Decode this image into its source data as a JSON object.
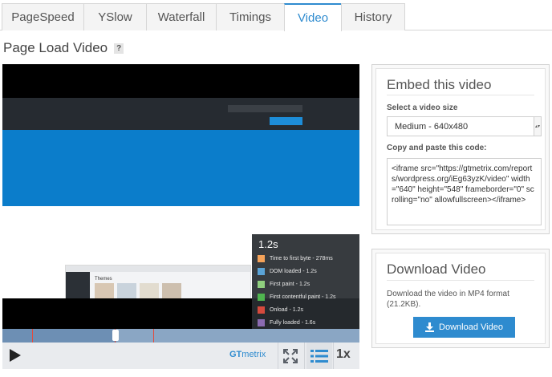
{
  "tabs": [
    {
      "label": "PageSpeed",
      "active": false
    },
    {
      "label": "YSlow",
      "active": false
    },
    {
      "label": "Waterfall",
      "active": false
    },
    {
      "label": "Timings",
      "active": false
    },
    {
      "label": "Video",
      "active": true
    },
    {
      "label": "History",
      "active": false
    }
  ],
  "page": {
    "title": "Page Load Video",
    "help_icon": "?"
  },
  "player": {
    "screenshot_heading": "Themes",
    "popup": {
      "time": "1.2s",
      "legend": [
        {
          "label": "Time to first byte - 278ms",
          "color": "#f4a259"
        },
        {
          "label": "DOM loaded - 1.2s",
          "color": "#5aa3d6"
        },
        {
          "label": "First paint - 1.2s",
          "color": "#8fcf7e"
        },
        {
          "label": "First contentful paint - 1.2s",
          "color": "#4fb54f"
        },
        {
          "label": "Onload - 1.2s",
          "color": "#d64a3d"
        },
        {
          "label": "Fully loaded - 1.6s",
          "color": "#8b6bb1"
        }
      ]
    },
    "progress": 0.32,
    "logo_gt": "GT",
    "logo_rest": "metrix",
    "speed": "1x",
    "icons": [
      "play-icon",
      "fullscreen-icon",
      "list-icon"
    ]
  },
  "embed": {
    "title": "Embed this video",
    "size_label": "Select a video size",
    "size_value": "Medium - 640x480",
    "code_label": "Copy and paste this code:",
    "code": "<iframe src=\"https://gtmetrix.com/reports/wordpress.org/iEg63yzK/video\" width=\"640\" height=\"548\" frameborder=\"0\" scrolling=\"no\" allowfullscreen></iframe>"
  },
  "download": {
    "title": "Download Video",
    "description": "Download the video in MP4 format (21.2KB).",
    "button_label": "Download Video"
  },
  "colors": {
    "accent": "#2e8bcf",
    "video_blue": "#0b7dcb"
  }
}
